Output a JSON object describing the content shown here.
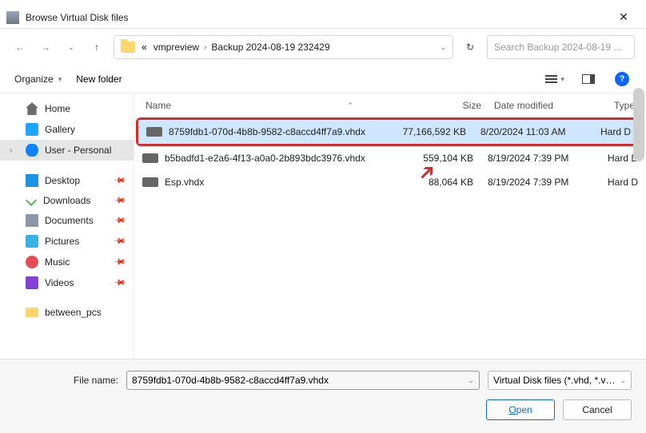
{
  "window": {
    "title": "Browse Virtual Disk files"
  },
  "breadcrumb": {
    "path1": "vmpreview",
    "path2": "Backup 2024-08-19 232429"
  },
  "search": {
    "placeholder": "Search Backup 2024-08-19 ..."
  },
  "toolbar": {
    "organize": "Organize",
    "newfolder": "New folder"
  },
  "sidebar": {
    "home": "Home",
    "gallery": "Gallery",
    "user": "User - Personal",
    "desktop": "Desktop",
    "downloads": "Downloads",
    "documents": "Documents",
    "pictures": "Pictures",
    "music": "Music",
    "videos": "Videos",
    "between": "between_pcs"
  },
  "columns": {
    "name": "Name",
    "size": "Size",
    "date": "Date modified",
    "type": "Type"
  },
  "files": [
    {
      "name": "8759fdb1-070d-4b8b-9582-c8accd4ff7a9.vhdx",
      "size": "77,166,592 KB",
      "date": "8/20/2024 11:03 AM",
      "type": "Hard D"
    },
    {
      "name": "b5badfd1-e2a6-4f13-a0a0-2b893bdc3976.vhdx",
      "size": "559,104 KB",
      "date": "8/19/2024 7:39 PM",
      "type": "Hard D"
    },
    {
      "name": "Esp.vhdx",
      "size": "88,064 KB",
      "date": "8/19/2024 7:39 PM",
      "type": "Hard D"
    }
  ],
  "bottom": {
    "filename_label": "File name:",
    "filename_value": "8759fdb1-070d-4b8b-9582-c8accd4ff7a9.vhdx",
    "filter": "Virtual Disk files (*.vhd, *.vhdx)",
    "open": "Open",
    "cancel": "Cancel"
  }
}
